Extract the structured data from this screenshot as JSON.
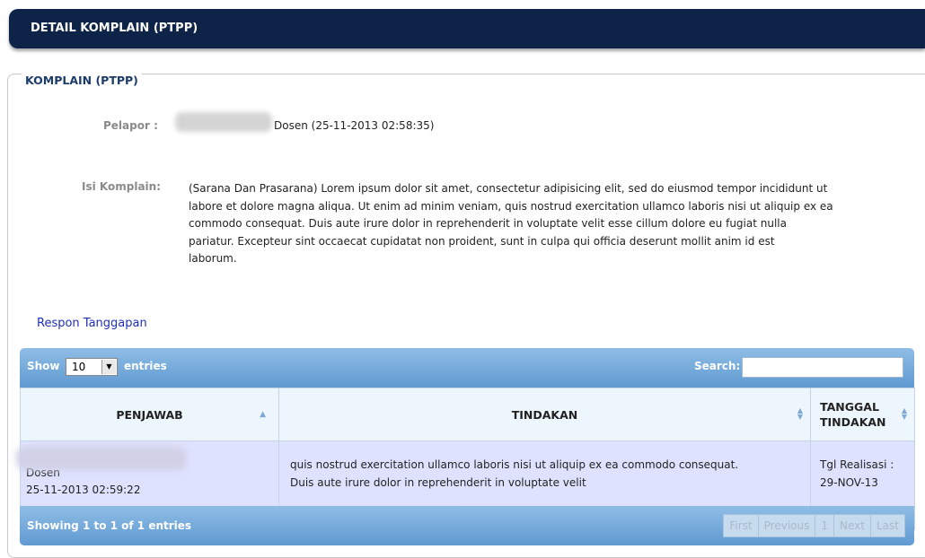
{
  "header": {
    "title": "DETAIL KOMPLAIN (PTPP)"
  },
  "komplain": {
    "legend": "KOMPLAIN (PTPP)",
    "pelapor_label": "Pelapor :",
    "pelapor_value": "Dosen (25-11-2013 02:58:35)",
    "isi_label": "Isi Komplain:",
    "isi_lines": [
      "(Sarana Dan Prasarana) Lorem ipsum dolor sit amet, consectetur adipisicing elit, sed do eiusmod tempor incididunt ut",
      "labore et dolore magna aliqua. Ut enim ad minim veniam, quis nostrud exercitation ullamco laboris nisi ut aliquip ex ea",
      "commodo consequat. Duis aute irure dolor in reprehenderit in voluptate velit esse cillum dolore eu fugiat nulla",
      "pariatur. Excepteur sint occaecat cupidatat non proident, sunt in culpa qui officia deserunt mollit anim id est",
      "laborum."
    ]
  },
  "respon_link": "Respon Tanggapan",
  "table": {
    "show_label": "Show",
    "show_value": "10",
    "entries_label": "entries",
    "search_label": "Search:",
    "columns": [
      "PENJAWAB",
      "TINDAKAN",
      "TANGGAL TINDAKAN"
    ],
    "rows": [
      {
        "penjawab": "Dosen",
        "penjawab_date": "25-11-2013 02:59:22",
        "tindakan_line1": "quis nostrud exercitation ullamco laboris nisi ut aliquip ex ea commodo consequat.",
        "tindakan_line2": "Duis aute irure dolor in reprehenderit in voluptate velit",
        "tanggal_line1": "Tgl Realisasi :",
        "tanggal_line2": "29-NOV-13"
      }
    ],
    "info": "Showing 1 to 1 of 1 entries",
    "pager": {
      "first": "First",
      "previous": "Previous",
      "page": "1",
      "next": "Next",
      "last": "Last"
    }
  }
}
